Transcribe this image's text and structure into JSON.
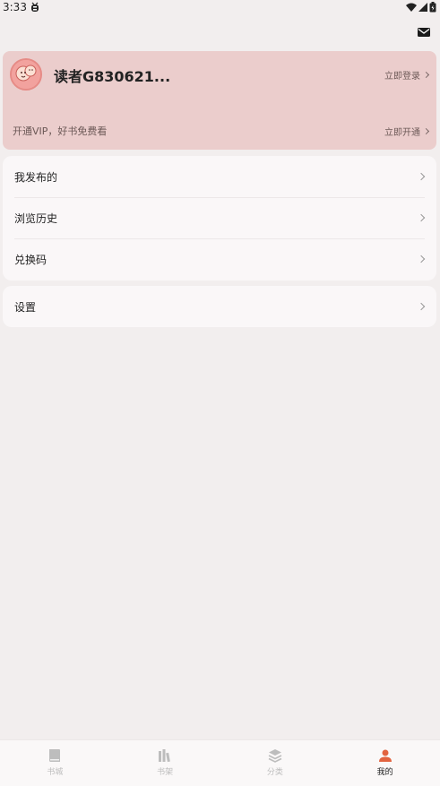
{
  "status_bar": {
    "time": "3:33",
    "notification_icon": "bug-icon",
    "right_icons": [
      "wifi-icon",
      "signal-icon",
      "battery-icon"
    ]
  },
  "top_bar": {
    "mail_icon": "mail-icon"
  },
  "profile": {
    "username": "读者G830621...",
    "login_label": "立即登录",
    "vip_text": "开通VIP，好书免费看",
    "vip_link": "立即开通",
    "card_color": "#ebcdcc"
  },
  "menu": {
    "group_one": [
      {
        "label": "我发布的"
      },
      {
        "label": "浏览历史"
      },
      {
        "label": "兑换码"
      }
    ],
    "group_two": [
      {
        "label": "设置"
      }
    ]
  },
  "bottom_nav": {
    "items": [
      {
        "label": "书城",
        "icon": "book-icon",
        "active": false
      },
      {
        "label": "书架",
        "icon": "bookshelf-icon",
        "active": false
      },
      {
        "label": "分类",
        "icon": "layers-icon",
        "active": false
      },
      {
        "label": "我的",
        "icon": "person-icon",
        "active": true
      }
    ],
    "active_color": "#e2633f",
    "inactive_color": "#bdbdbd"
  }
}
